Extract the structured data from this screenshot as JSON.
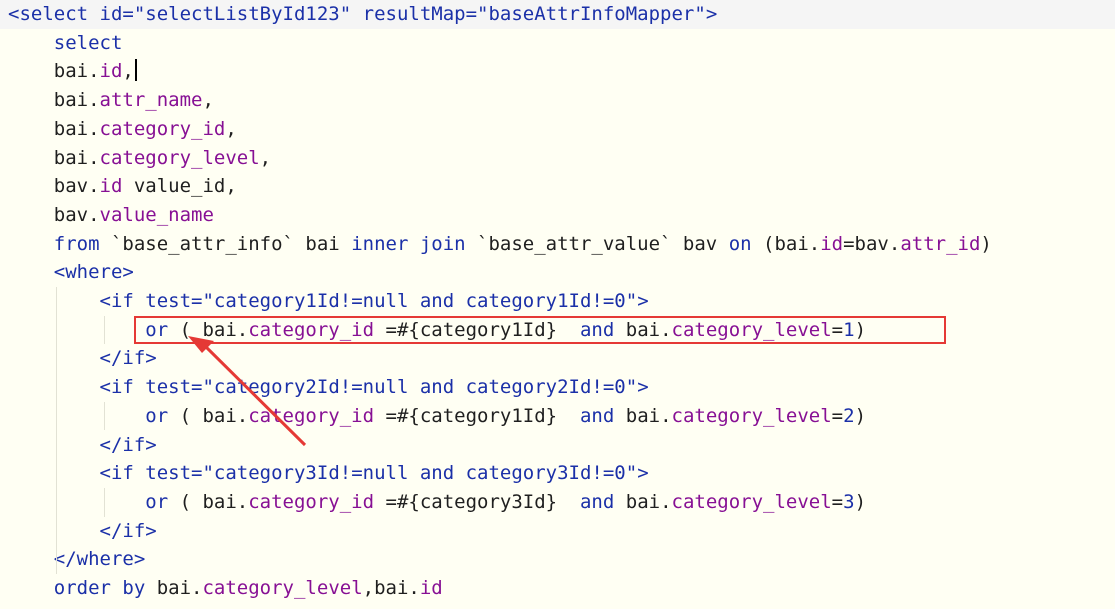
{
  "editor": {
    "lines": [
      [
        {
          "t": "<select",
          "c": "tag"
        },
        {
          "t": " id=",
          "c": "attr"
        },
        {
          "t": "\"selectListById123\"",
          "c": "str"
        },
        {
          "t": " resultMap=",
          "c": "attr"
        },
        {
          "t": "\"baseAttrInfoMapper\"",
          "c": "str"
        },
        {
          "t": ">",
          "c": "tag"
        }
      ],
      [
        {
          "t": "    select",
          "c": "kw"
        }
      ],
      [
        {
          "t": "    bai.",
          "c": "plain"
        },
        {
          "t": "id",
          "c": "field"
        },
        {
          "t": ",",
          "c": "plain"
        }
      ],
      [
        {
          "t": "    bai.",
          "c": "plain"
        },
        {
          "t": "attr_name",
          "c": "field"
        },
        {
          "t": ",",
          "c": "plain"
        }
      ],
      [
        {
          "t": "    bai.",
          "c": "plain"
        },
        {
          "t": "category_id",
          "c": "field"
        },
        {
          "t": ",",
          "c": "plain"
        }
      ],
      [
        {
          "t": "    bai.",
          "c": "plain"
        },
        {
          "t": "category_level",
          "c": "field"
        },
        {
          "t": ",",
          "c": "plain"
        }
      ],
      [
        {
          "t": "    bav.",
          "c": "plain"
        },
        {
          "t": "id",
          "c": "field"
        },
        {
          "t": " value_id,",
          "c": "plain"
        }
      ],
      [
        {
          "t": "    bav.",
          "c": "plain"
        },
        {
          "t": "value_name",
          "c": "field"
        }
      ],
      [
        {
          "t": "    from",
          "c": "kw"
        },
        {
          "t": " `base_attr_info` bai ",
          "c": "plain"
        },
        {
          "t": "inner join",
          "c": "kw"
        },
        {
          "t": " `base_attr_value` bav ",
          "c": "plain"
        },
        {
          "t": "on",
          "c": "kw"
        },
        {
          "t": " (bai.",
          "c": "plain"
        },
        {
          "t": "id",
          "c": "field"
        },
        {
          "t": "=bav.",
          "c": "plain"
        },
        {
          "t": "attr_id",
          "c": "field"
        },
        {
          "t": ")",
          "c": "plain"
        }
      ],
      [
        {
          "t": "    <where",
          "c": "tag"
        },
        {
          "t": ">",
          "c": "tag"
        }
      ],
      [
        {
          "t": "        <if",
          "c": "tag"
        },
        {
          "t": " test=",
          "c": "attr"
        },
        {
          "t": "\"category1Id!=null ",
          "c": "str"
        },
        {
          "t": "and",
          "c": "kw"
        },
        {
          "t": " category1Id!=0\"",
          "c": "str"
        },
        {
          "t": ">",
          "c": "tag"
        }
      ],
      [
        {
          "t": "            or",
          "c": "kw"
        },
        {
          "t": " ( bai.",
          "c": "plain"
        },
        {
          "t": "category_id",
          "c": "field"
        },
        {
          "t": " =#{category1Id}  ",
          "c": "plain"
        },
        {
          "t": "and",
          "c": "kw"
        },
        {
          "t": " bai.",
          "c": "plain"
        },
        {
          "t": "category_level",
          "c": "field"
        },
        {
          "t": "=",
          "c": "plain"
        },
        {
          "t": "1",
          "c": "num"
        },
        {
          "t": ")",
          "c": "plain"
        }
      ],
      [
        {
          "t": "        </if>",
          "c": "tag"
        }
      ],
      [
        {
          "t": "        <if",
          "c": "tag"
        },
        {
          "t": " test=",
          "c": "attr"
        },
        {
          "t": "\"category2Id!=null ",
          "c": "str"
        },
        {
          "t": "and",
          "c": "kw"
        },
        {
          "t": " category2Id!=0\"",
          "c": "str"
        },
        {
          "t": ">",
          "c": "tag"
        }
      ],
      [
        {
          "t": "            or",
          "c": "kw"
        },
        {
          "t": " ( bai.",
          "c": "plain"
        },
        {
          "t": "category_id",
          "c": "field"
        },
        {
          "t": " =#{category1Id}  ",
          "c": "plain"
        },
        {
          "t": "and",
          "c": "kw"
        },
        {
          "t": " bai.",
          "c": "plain"
        },
        {
          "t": "category_level",
          "c": "field"
        },
        {
          "t": "=",
          "c": "plain"
        },
        {
          "t": "2",
          "c": "num"
        },
        {
          "t": ")",
          "c": "plain"
        }
      ],
      [
        {
          "t": "        </if>",
          "c": "tag"
        }
      ],
      [
        {
          "t": "        <if",
          "c": "tag"
        },
        {
          "t": " test=",
          "c": "attr"
        },
        {
          "t": "\"category3Id!=null ",
          "c": "str"
        },
        {
          "t": "and",
          "c": "kw"
        },
        {
          "t": " category3Id!=0\"",
          "c": "str"
        },
        {
          "t": ">",
          "c": "tag"
        }
      ],
      [
        {
          "t": "            or",
          "c": "kw"
        },
        {
          "t": " ( bai.",
          "c": "plain"
        },
        {
          "t": "category_id",
          "c": "field"
        },
        {
          "t": " =#{category3Id}  ",
          "c": "plain"
        },
        {
          "t": "and",
          "c": "kw"
        },
        {
          "t": " bai.",
          "c": "plain"
        },
        {
          "t": "category_level",
          "c": "field"
        },
        {
          "t": "=",
          "c": "plain"
        },
        {
          "t": "3",
          "c": "num"
        },
        {
          "t": ")",
          "c": "plain"
        }
      ],
      [
        {
          "t": "        </if>",
          "c": "tag"
        }
      ],
      [
        {
          "t": "    </where>",
          "c": "tag"
        }
      ],
      [
        {
          "t": "    order by",
          "c": "kw"
        },
        {
          "t": " bai.",
          "c": "plain"
        },
        {
          "t": "category_level",
          "c": "field"
        },
        {
          "t": ",bai.",
          "c": "plain"
        },
        {
          "t": "id",
          "c": "field"
        }
      ]
    ],
    "caret_line": 2,
    "colors": {
      "background": "#fffff3",
      "tag": "#1b30a8",
      "keyword": "#1b30a8",
      "field": "#871094",
      "plain": "#1f1f1f",
      "annotation": "#e53935"
    }
  },
  "annotation": {
    "highlight_line": 11,
    "color": "#e53935",
    "arrow": "arrow-pointing-to-highlighted-line"
  }
}
